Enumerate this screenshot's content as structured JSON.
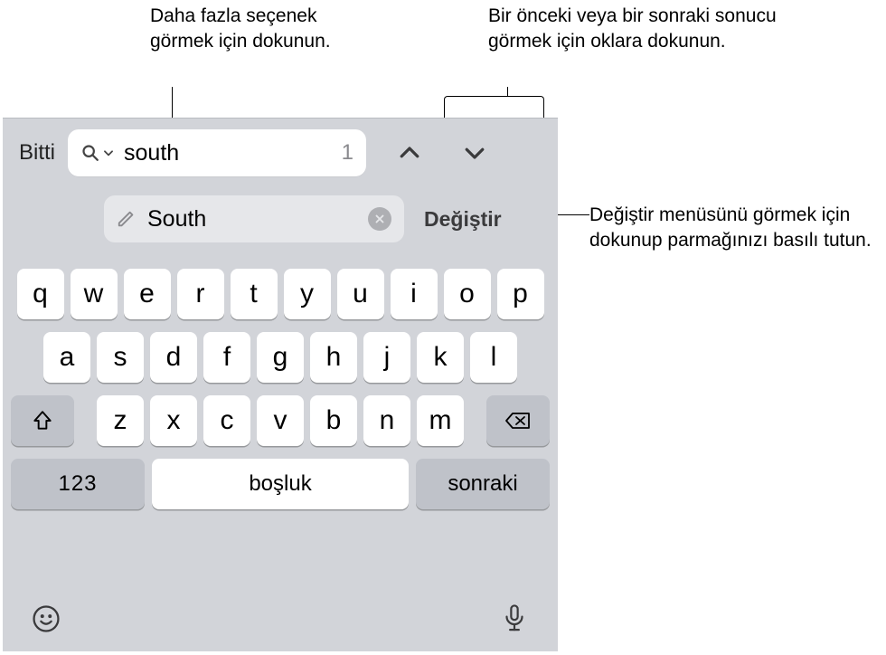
{
  "callouts": {
    "more_options": "Daha fazla seçenek görmek için dokunun.",
    "arrows": "Bir önceki veya bir sonraki sonucu görmek için oklara dokunun.",
    "replace_hold": "Değiştir menüsünü görmek için dokunup parmağınızı basılı tutun."
  },
  "toolbar": {
    "done_label": "Bitti",
    "search_value": "south",
    "search_count": "1"
  },
  "replace": {
    "value": "South",
    "button_label": "Değiştir"
  },
  "keyboard": {
    "row1": [
      "q",
      "w",
      "e",
      "r",
      "t",
      "y",
      "u",
      "i",
      "o",
      "p"
    ],
    "row2": [
      "a",
      "s",
      "d",
      "f",
      "g",
      "h",
      "j",
      "k",
      "l"
    ],
    "row3": [
      "z",
      "x",
      "c",
      "v",
      "b",
      "n",
      "m"
    ],
    "numbers_label": "123",
    "space_label": "boşluk",
    "next_label": "sonraki"
  },
  "icons": {
    "search": "search-icon",
    "chevron_down_small": "chevron-down-icon",
    "chevron_up": "chevron-up-icon",
    "chevron_down": "chevron-down-icon",
    "pencil": "pencil-icon",
    "clear": "clear-icon",
    "shift": "shift-icon",
    "backspace": "backspace-icon",
    "emoji": "emoji-icon",
    "mic": "mic-icon"
  }
}
